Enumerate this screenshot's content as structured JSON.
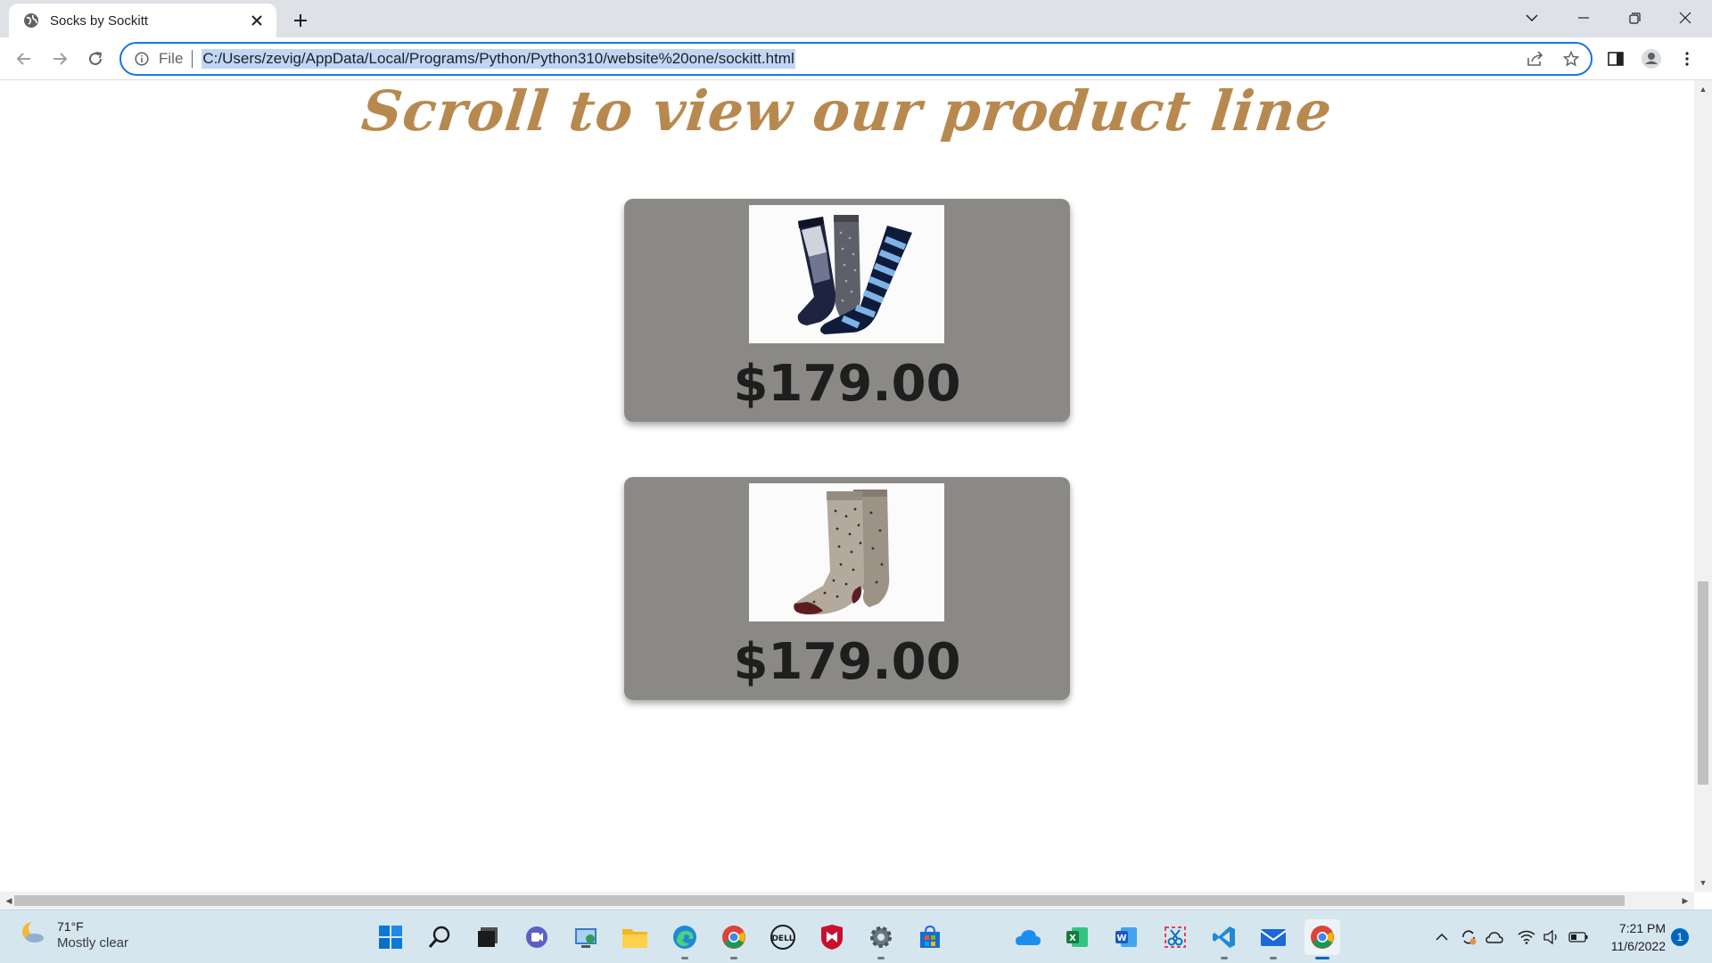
{
  "browser": {
    "tab_title": "Socks by Sockitt",
    "url_scheme": "File",
    "url": "C:/Users/zevig/AppData/Local/Programs/Python/Python310/website%20one/sockitt.html"
  },
  "page": {
    "heading": "Scroll to view our product line",
    "products": [
      {
        "image": "argyle-striped-dot-socks-image",
        "price": "$179.00"
      },
      {
        "image": "polka-dot-socks-image",
        "price": "$179.00"
      }
    ]
  },
  "taskbar": {
    "weather": {
      "temp": "71°F",
      "condition": "Mostly clear"
    },
    "clock": {
      "time": "7:21 PM",
      "date": "11/6/2022"
    },
    "notification_count": "1",
    "apps": [
      "start",
      "search",
      "task-view",
      "teams",
      "control-panel",
      "file-explorer",
      "edge",
      "chrome",
      "dell",
      "mcafee",
      "settings",
      "microsoft-store",
      "onedrive",
      "excel",
      "word",
      "snipping-tool",
      "vscode",
      "mail",
      "chrome-active"
    ]
  },
  "colors": {
    "heading": "#b8894f",
    "card": "#8b8985",
    "accent": "#1a73e8",
    "taskbar": "#d6e6ef"
  }
}
